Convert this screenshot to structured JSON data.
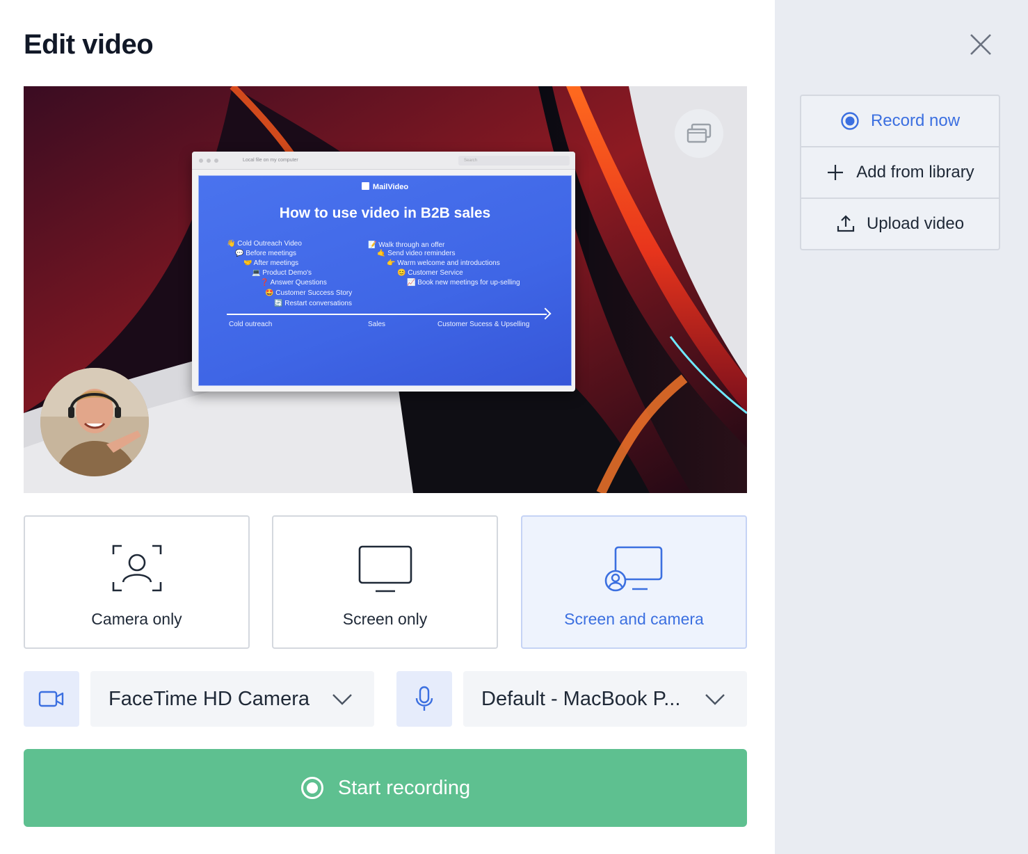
{
  "title": "Edit video",
  "preview": {
    "window_title": "Local file on my computer",
    "search_placeholder": "Search",
    "slide": {
      "brand": "MailVideo",
      "title": "How to use video in B2B sales",
      "left_items": [
        "👋 Cold Outreach Video",
        "💬 Before meetings",
        "🤝 After meetings",
        "💻 Product Demo's",
        "❓ Answer Questions",
        "🤩 Customer Success Story",
        "🔄 Restart conversations"
      ],
      "right_items": [
        "📝 Walk through an offer",
        "🤙 Send video reminders",
        "👉 Warm welcome and introductions",
        "😊 Customer Service",
        "📈 Book new meetings for up-selling"
      ],
      "axis_labels": [
        "Cold outreach",
        "Sales",
        "Customer Sucess & Upselling"
      ]
    }
  },
  "modes": [
    {
      "label": "Camera only",
      "icon": "camera-frame-icon",
      "active": false
    },
    {
      "label": "Screen only",
      "icon": "monitor-icon",
      "active": false
    },
    {
      "label": "Screen and camera",
      "icon": "screen-and-camera-icon",
      "active": true
    }
  ],
  "devices": {
    "camera": {
      "value": "FaceTime HD Camera",
      "icon": "video-camera-icon"
    },
    "microphone": {
      "value": "Default - MacBook P...",
      "icon": "microphone-icon"
    }
  },
  "start_button": {
    "label": "Start recording"
  },
  "side_menu": {
    "items": [
      {
        "label": "Record now",
        "icon": "record-icon"
      },
      {
        "label": "Add from library",
        "icon": "plus-icon"
      },
      {
        "label": "Upload video",
        "icon": "upload-icon"
      }
    ]
  },
  "colors": {
    "accent": "#3b6fe0",
    "start_button": "#5ec090",
    "sidebar_bg": "#e9ecf2",
    "active_card_bg": "#eef3fd"
  }
}
